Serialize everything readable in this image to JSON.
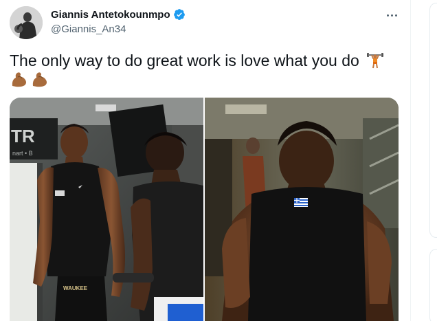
{
  "tweet": {
    "author": {
      "display_name": "Giannis Antetokounmpo",
      "handle": "@Giannis_An34",
      "verified": true
    },
    "text": "The only way to do great work is love what you do",
    "emojis": [
      "weight-lifter-emoji",
      "flexed-biceps-emoji",
      "flexed-biceps-emoji"
    ],
    "media": [
      {
        "kind": "photo",
        "subject": "gym-photo-two-players",
        "wall_sign": "TR",
        "wall_sign_sub": "nart • B",
        "shorts_text": "WAUKEE"
      },
      {
        "kind": "photo",
        "subject": "gym-photo-back-view"
      }
    ]
  },
  "colors": {
    "verified_blue": "#1d9bf0",
    "secondary_text": "#536471",
    "primary_text": "#0f1419",
    "divider": "#eff3f4"
  }
}
